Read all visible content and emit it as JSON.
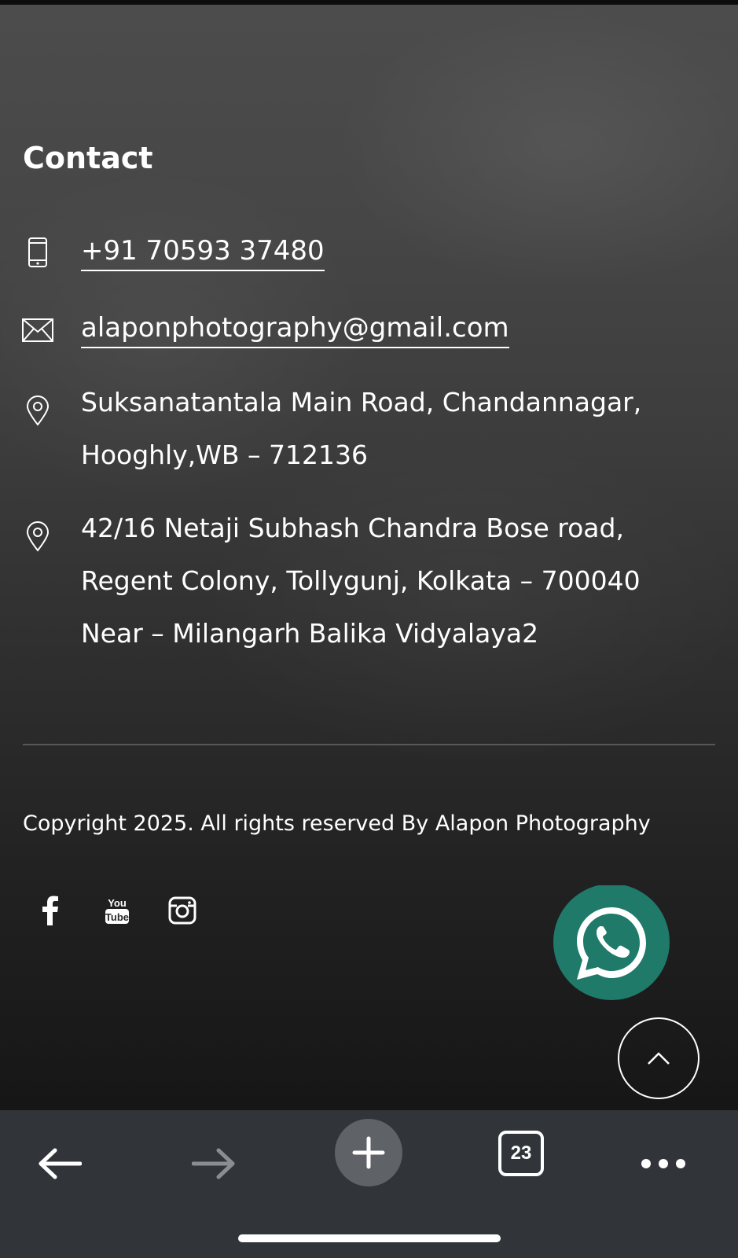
{
  "contact": {
    "title": "Contact",
    "phone": {
      "icon": "mobile-phone-icon",
      "text": "+91 70593 37480"
    },
    "email": {
      "icon": "envelope-icon",
      "text": "alaponphotography@gmail.com"
    },
    "address1": {
      "icon": "location-pin-icon",
      "lines": [
        "Suksanatantala Main Road, Chandannagar,",
        "Hooghly,WB – 712136"
      ]
    },
    "address2": {
      "icon": "location-pin-icon",
      "lines": [
        "42/16 Netaji Subhash Chandra Bose road,",
        "Regent Colony, Tollygunj, Kolkata – 700040",
        "Near – Milangarh Balika Vidyalaya2"
      ]
    }
  },
  "footer": {
    "copyright": "Copyright 2025. All rights reserved By Alapon Photography",
    "social": [
      {
        "name": "facebook-icon"
      },
      {
        "name": "youtube-icon",
        "glyph_lines": [
          "You",
          "Tube"
        ]
      },
      {
        "name": "instagram-icon"
      }
    ]
  },
  "floating": {
    "whatsapp": {
      "icon": "whatsapp-icon",
      "color": "#1f7a6a"
    },
    "scroll_top": {
      "icon": "chevron-up-icon"
    }
  },
  "browser_nav": {
    "back": "back-arrow-icon",
    "forward": "forward-arrow-icon",
    "new_tab": "plus-icon",
    "tab_count": "23",
    "menu": "more-dots-icon"
  },
  "colors": {
    "background_top": "#4c4c4c",
    "background_bottom": "#161616",
    "text": "#ffffff",
    "navbar": "#31353a",
    "new_tab_button": "#5f6368",
    "disabled_icon": "#8a8d91"
  }
}
